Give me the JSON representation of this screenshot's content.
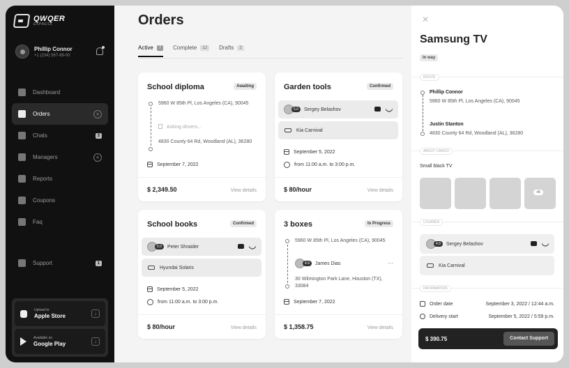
{
  "brand": {
    "name": "QWQER",
    "sub": "EXPRESS"
  },
  "user": {
    "name": "Phillip Connor",
    "phone": "+1 (234) 567-89-00"
  },
  "nav": [
    {
      "label": "Dashboard",
      "icon": "dashboard-icon"
    },
    {
      "label": "Orders",
      "icon": "orders-icon",
      "active": true
    },
    {
      "label": "Chats",
      "icon": "chats-icon",
      "count": "3"
    },
    {
      "label": "Managers",
      "icon": "managers-icon"
    },
    {
      "label": "Reports",
      "icon": "reports-icon"
    },
    {
      "label": "Coupons",
      "icon": "coupons-icon"
    },
    {
      "label": "Faq",
      "icon": "faq-icon"
    }
  ],
  "support": {
    "label": "Support",
    "count": "1"
  },
  "stores": [
    {
      "small": "Upload to",
      "big": "Apple Store"
    },
    {
      "small": "Available on",
      "big": "Google Play"
    }
  ],
  "page": {
    "title": "Orders"
  },
  "tabs": [
    {
      "label": "Active",
      "count": "7"
    },
    {
      "label": "Complete",
      "count": "12"
    },
    {
      "label": "Drafts",
      "count": "2"
    }
  ],
  "cards": {
    "c1": {
      "title": "School diploma",
      "status": "Awaiting",
      "from": "5960 W 85th Pl, Los Angeles (CA), 90045",
      "waiting": "Asking drivers...",
      "to": "4830 County 64 Rd, Woodland (AL), 36280",
      "date": "September 7, 2022",
      "price": "$ 2,349.50",
      "view": "View details"
    },
    "c2": {
      "title": "Garden tools",
      "status": "Confirmed",
      "rating": "5.0",
      "courier": "Sergey Belashov",
      "car": "Kia Carnival",
      "date": "September 5, 2022",
      "time": "from 11:00 a.m. to 3:00 p.m.",
      "price": "$ 80/hour",
      "view": "View details"
    },
    "c3": {
      "title": "School books",
      "status": "Confirmed",
      "rating": "5.0",
      "courier": "Peter Shraider",
      "car": "Hyundai Solaris",
      "date": "September 5, 2022",
      "time": "from 11:00 a.m. to 3:00 p.m.",
      "price": "$ 80/hour",
      "view": "View details"
    },
    "c4": {
      "title": "3 boxes",
      "status": "In Progress",
      "from": "5960 W 85th Pl, Los Angeles (CA), 90045",
      "rating": "4.9",
      "courier": "James Dias",
      "to": "30 Wilmington Park Lane, Houston (TX), 33084",
      "date": "September 7, 2022",
      "price": "$ 1,358.75",
      "view": "View details"
    }
  },
  "panel": {
    "title": "Samsung TV",
    "status": "In way",
    "route_label": "ROUTE",
    "from_name": "Phillip Connor",
    "from_addr": "5960 W 85th Pl, Los Angeles (CA), 90045",
    "to_name": "Justin Stanton",
    "to_addr": "4830 County 64 Rd, Woodland (AL), 36280",
    "cargo_label": "ABOUT CARGO",
    "cargo": "Small black TV",
    "more": "+5",
    "courier_label": "COURIER",
    "rating": "4.9",
    "courier": "Sergey Belashov",
    "car": "Kia Carnival",
    "info_label": "INFORMATION",
    "order_date_label": "Order date",
    "order_date": "September 3, 2022 / 12:44 a.m.",
    "delivery_label": "Delivery start",
    "delivery": "September 5, 2022 / 5:59 p.m.",
    "total": "$ 390.75",
    "contact": "Contact Support"
  }
}
